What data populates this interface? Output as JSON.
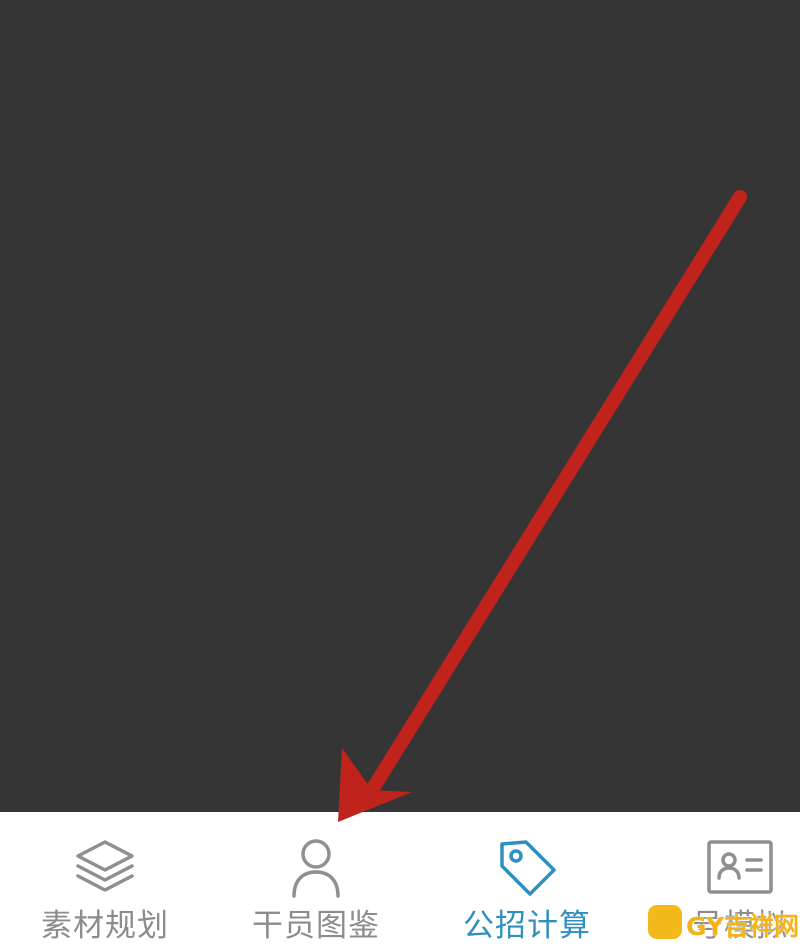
{
  "tabbar": {
    "tabs": [
      {
        "label": "素材规划",
        "icon": "layers-icon",
        "active": false
      },
      {
        "label": "干员图鉴",
        "icon": "person-icon",
        "active": false
      },
      {
        "label": "公招计算",
        "icon": "tag-icon",
        "active": true
      },
      {
        "label": "号模拟",
        "icon": "id-card-icon",
        "active": false
      }
    ]
  },
  "watermark": {
    "text": "GY吉祥网"
  },
  "colors": {
    "content_background": "#353535",
    "tab_inactive": "#8c8c8c",
    "tab_active": "#2f8fbf",
    "annotation_arrow": "#c0231c",
    "watermark": "#f4b417"
  }
}
